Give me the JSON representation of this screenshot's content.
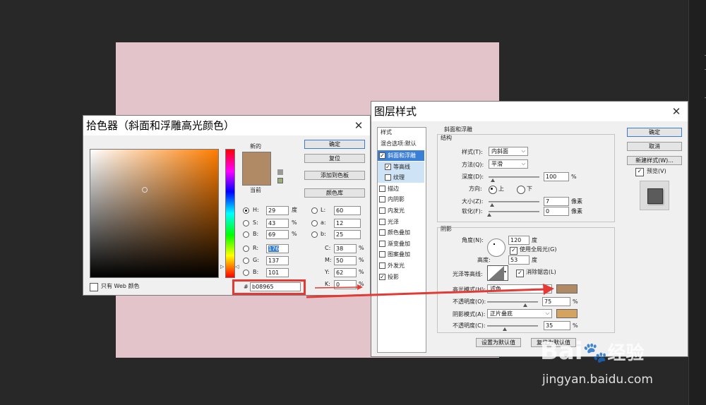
{
  "picker": {
    "title": "拾色器（斜面和浮雕高光颜色）",
    "new_label": "新的",
    "current_label": "当前",
    "buttons": {
      "ok": "确定",
      "reset": "复位",
      "add_swatch": "添加到色板",
      "color_lib": "颜色库"
    },
    "hsb": {
      "h_label": "H:",
      "h": "29",
      "h_unit": "度",
      "s_label": "S:",
      "s": "43",
      "s_unit": "%",
      "b_label": "B:",
      "b": "69",
      "b_unit": "%"
    },
    "rgb": {
      "r_label": "R:",
      "r": "176",
      "g_label": "G:",
      "g": "137",
      "b_label": "B:",
      "b": "101"
    },
    "lab": {
      "l_label": "L:",
      "l": "60",
      "a_label": "a:",
      "a": "12",
      "b_label": "b:",
      "b": "25"
    },
    "cmyk": {
      "c_label": "C:",
      "c": "38",
      "m_label": "M:",
      "m": "50",
      "y_label": "Y:",
      "y": "62",
      "k_label": "K:",
      "k": "0",
      "unit": "%"
    },
    "hex_label": "#",
    "hex": "b08965",
    "web_only": "只有 Web 颜色",
    "current_color": "#b08965",
    "field_hue_color": "#ff7d00"
  },
  "layer_style": {
    "title": "图层样式",
    "styles_header": "样式",
    "blend_default": "混合选项:默认",
    "effects": [
      {
        "label": "斜面和浮雕",
        "checked": true
      },
      {
        "label": "等高线",
        "checked": true
      },
      {
        "label": "纹理",
        "checked": false
      },
      {
        "label": "描边",
        "checked": false
      },
      {
        "label": "内阴影",
        "checked": false
      },
      {
        "label": "内发光",
        "checked": false
      },
      {
        "label": "光泽",
        "checked": false
      },
      {
        "label": "颜色叠加",
        "checked": false
      },
      {
        "label": "渐变叠加",
        "checked": false
      },
      {
        "label": "图案叠加",
        "checked": false
      },
      {
        "label": "外发光",
        "checked": false
      },
      {
        "label": "投影",
        "checked": true
      }
    ],
    "bevel_title": "斜面和浮雕",
    "structure_title": "结构",
    "style_label": "样式(T):",
    "style_value": "内斜面",
    "technique_label": "方法(Q):",
    "technique_value": "平滑",
    "depth_label": "深度(D):",
    "depth_value": "100",
    "depth_unit": "%",
    "direction_label": "方向:",
    "dir_up": "上",
    "dir_down": "下",
    "size_label": "大小(Z):",
    "size_value": "7",
    "size_unit": "像素",
    "soften_label": "软化(F):",
    "soften_value": "0",
    "soften_unit": "像素",
    "shading_title": "阴影",
    "angle_label": "角度(N):",
    "angle_value": "120",
    "angle_unit": "度",
    "global_light": "使用全局光(G)",
    "altitude_label": "高度:",
    "altitude_value": "53",
    "altitude_unit": "度",
    "gloss_label": "光泽等高线:",
    "anti_alias": "消除锯齿(L)",
    "highlight_label": "高光模式(H):",
    "highlight_value": "滤色",
    "highlight_color": "#b08965",
    "opacity1_label": "不透明度(O):",
    "opacity1_value": "75",
    "shadow_mode_label": "阴影模式(A):",
    "shadow_mode_value": "正片叠底",
    "shadow_color": "#d4a35f",
    "opacity2_label": "不透明度(C):",
    "opacity2_value": "35",
    "percent": "%",
    "make_default": "设置为默认值",
    "reset_default": "复位为默认值",
    "ok": "确定",
    "cancel": "取消",
    "new_style": "新建样式(W)...",
    "preview": "预览(V)"
  },
  "watermark": {
    "brand": "Bai",
    "brand2": "经验",
    "url": "jingyan.baidu.com"
  }
}
